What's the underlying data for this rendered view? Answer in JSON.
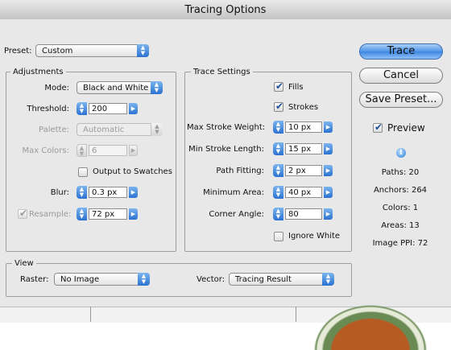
{
  "window": {
    "title": "Tracing Options"
  },
  "preset": {
    "label": "Preset:",
    "value": "Custom"
  },
  "adjustments": {
    "legend": "Adjustments",
    "mode": {
      "label": "Mode:",
      "value": "Black and White"
    },
    "threshold": {
      "label": "Threshold:",
      "value": "200"
    },
    "palette": {
      "label": "Palette:",
      "value": "Automatic"
    },
    "max_colors": {
      "label": "Max Colors:",
      "value": "6"
    },
    "output_to_swatches": {
      "label": "Output to Swatches",
      "checked": false
    },
    "blur": {
      "label": "Blur:",
      "value": "0.3 px"
    },
    "resample": {
      "label": "Resample:",
      "value": "72 px",
      "checked": true
    }
  },
  "trace_settings": {
    "legend": "Trace Settings",
    "fills": {
      "label": "Fills",
      "checked": true
    },
    "strokes": {
      "label": "Strokes",
      "checked": true
    },
    "max_stroke_weight": {
      "label": "Max Stroke Weight:",
      "value": "10 px"
    },
    "min_stroke_length": {
      "label": "Min Stroke Length:",
      "value": "15 px"
    },
    "path_fitting": {
      "label": "Path Fitting:",
      "value": "2 px"
    },
    "minimum_area": {
      "label": "Minimum Area:",
      "value": "40 px"
    },
    "corner_angle": {
      "label": "Corner Angle:",
      "value": "80"
    },
    "ignore_white": {
      "label": "Ignore White",
      "checked": false
    }
  },
  "view": {
    "legend": "View",
    "raster": {
      "label": "Raster:",
      "value": "No Image"
    },
    "vector": {
      "label": "Vector:",
      "value": "Tracing Result"
    }
  },
  "buttons": {
    "trace": "Trace",
    "cancel": "Cancel",
    "save_preset": "Save Preset..."
  },
  "preview": {
    "label": "Preview",
    "checked": true
  },
  "stats": {
    "paths": "Paths: 20",
    "anchors": "Anchors: 264",
    "colors": "Colors: 1",
    "areas": "Areas: 13",
    "image_ppi": "Image PPI: 72"
  },
  "icons": {
    "info": "info-icon",
    "stepper": "up-down-arrows",
    "popup": "up-down-arrows",
    "menu": "right-triangle"
  },
  "colors": {
    "accent": "#3b86e2",
    "dialog_bg": "#e8e8e8",
    "disabled_text": "#9a9a9a"
  }
}
